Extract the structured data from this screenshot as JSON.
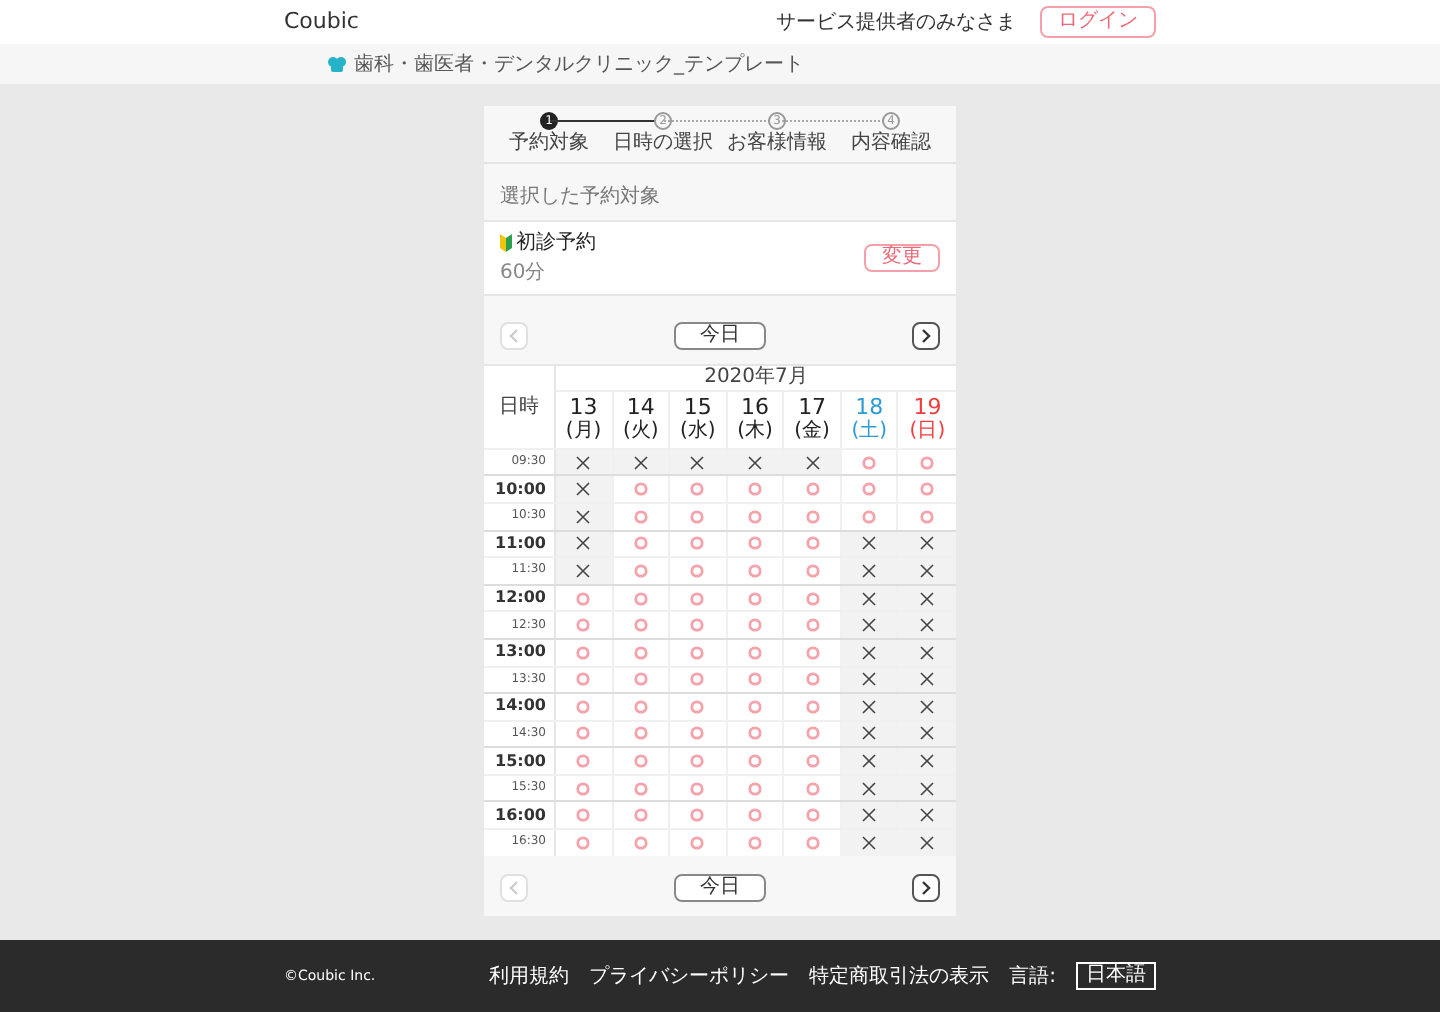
{
  "header": {
    "logo": "Coubic",
    "provider_link": "サービス提供者のみなさま",
    "login_button": "ログイン"
  },
  "breadcrumb": {
    "title": "歯科・歯医者・デンタルクリニック_テンプレート"
  },
  "steps": [
    {
      "number": "1",
      "label": "予約対象",
      "selected": true
    },
    {
      "number": "2",
      "label": "日時の選択",
      "selected": false
    },
    {
      "number": "3",
      "label": "お客様情報",
      "selected": false
    },
    {
      "number": "4",
      "label": "内容確認",
      "selected": false
    }
  ],
  "selection": {
    "heading": "選択した予約対象",
    "name": "初診予約",
    "duration": "60分",
    "change_button": "変更"
  },
  "nav_top": {
    "prev_disabled": true,
    "next_disabled": false,
    "today_button": "今日"
  },
  "calendar": {
    "corner_label": "日時",
    "month": "2020年7月",
    "days": [
      {
        "date": "13",
        "weekday": "(月)",
        "color": "#222222"
      },
      {
        "date": "14",
        "weekday": "(火)",
        "color": "#222222"
      },
      {
        "date": "15",
        "weekday": "(水)",
        "color": "#222222"
      },
      {
        "date": "16",
        "weekday": "(木)",
        "color": "#222222"
      },
      {
        "date": "17",
        "weekday": "(金)",
        "color": "#222222"
      },
      {
        "date": "18",
        "weekday": "(土)",
        "color": "#2e9bd6"
      },
      {
        "date": "19",
        "weekday": "(日)",
        "color": "#f03c3c"
      }
    ],
    "rows": [
      {
        "time": "09:30",
        "kind": "half",
        "slots": [
          false,
          false,
          false,
          false,
          false,
          true,
          true
        ]
      },
      {
        "time": "10:00",
        "kind": "hour",
        "slots": [
          false,
          true,
          true,
          true,
          true,
          true,
          true
        ]
      },
      {
        "time": "10:30",
        "kind": "half",
        "slots": [
          false,
          true,
          true,
          true,
          true,
          true,
          true
        ]
      },
      {
        "time": "11:00",
        "kind": "hour",
        "slots": [
          false,
          true,
          true,
          true,
          true,
          false,
          false
        ]
      },
      {
        "time": "11:30",
        "kind": "half",
        "slots": [
          false,
          true,
          true,
          true,
          true,
          false,
          false
        ]
      },
      {
        "time": "12:00",
        "kind": "hour",
        "slots": [
          true,
          true,
          true,
          true,
          true,
          false,
          false
        ]
      },
      {
        "time": "12:30",
        "kind": "half",
        "slots": [
          true,
          true,
          true,
          true,
          true,
          false,
          false
        ]
      },
      {
        "time": "13:00",
        "kind": "hour",
        "slots": [
          true,
          true,
          true,
          true,
          true,
          false,
          false
        ]
      },
      {
        "time": "13:30",
        "kind": "half",
        "slots": [
          true,
          true,
          true,
          true,
          true,
          false,
          false
        ]
      },
      {
        "time": "14:00",
        "kind": "hour",
        "slots": [
          true,
          true,
          true,
          true,
          true,
          false,
          false
        ]
      },
      {
        "time": "14:30",
        "kind": "half",
        "slots": [
          true,
          true,
          true,
          true,
          true,
          false,
          false
        ]
      },
      {
        "time": "15:00",
        "kind": "hour",
        "slots": [
          true,
          true,
          true,
          true,
          true,
          false,
          false
        ]
      },
      {
        "time": "15:30",
        "kind": "half",
        "slots": [
          true,
          true,
          true,
          true,
          true,
          false,
          false
        ]
      },
      {
        "time": "16:00",
        "kind": "hour",
        "slots": [
          true,
          true,
          true,
          true,
          true,
          false,
          false
        ]
      },
      {
        "time": "16:30",
        "kind": "half",
        "slots": [
          true,
          true,
          true,
          true,
          true,
          false,
          false
        ]
      }
    ]
  },
  "nav_bottom": {
    "prev_disabled": true,
    "next_disabled": false,
    "today_button": "今日"
  },
  "footer": {
    "copyright": "©Coubic Inc.",
    "links": [
      "利用規約",
      "プライバシーポリシー",
      "特定商取引法の表示"
    ],
    "language_label": "言語:",
    "language_button": "日本語"
  }
}
